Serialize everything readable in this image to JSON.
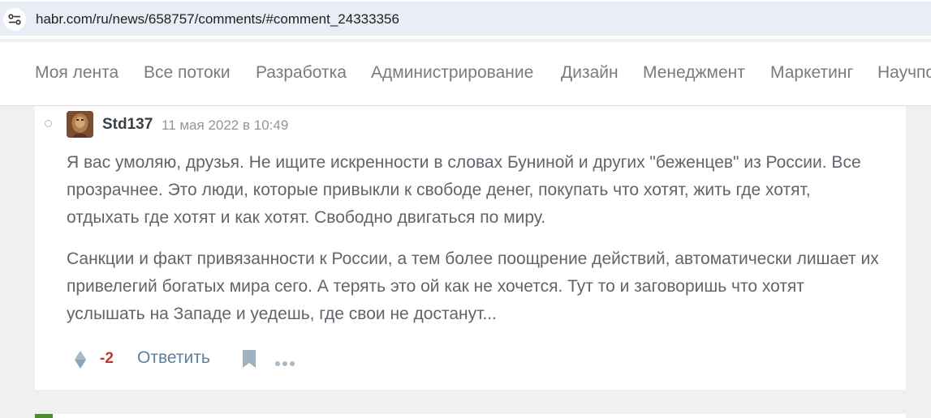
{
  "browser": {
    "url": "habr.com/ru/news/658757/comments/#comment_24333356",
    "site_icon": "tune-icon"
  },
  "nav": {
    "items": [
      {
        "label": "Моя лента"
      },
      {
        "label": "Все потоки"
      },
      {
        "label": "Разработка"
      },
      {
        "label": "Администрирование"
      },
      {
        "label": "Дизайн"
      },
      {
        "label": "Менеджмент"
      },
      {
        "label": "Маркетинг"
      },
      {
        "label": "Научпоп"
      }
    ]
  },
  "comment": {
    "author": "Std137",
    "time": "11 мая 2022 в 10:49",
    "paragraphs": [
      "Я вас умоляю, друзья. Не ищите искренности в словах Буниной и других \"беженцев\" из России. Все прозрачнее. Это люди, которые привыкли к свободе денег, покупать что хотят, жить где хотят, отдыхать где хотят и как хотят. Свободно двигаться по миру.",
      "Санкции и факт привязанности к России, а тем более поощрение действий, автоматически лишает их привелегий богатых мира сего. А терять это ой как не хочется. Тут то и заговоришь что хотят услышать на Западе и уедешь, где свои не достанут..."
    ],
    "score": "-2",
    "reply_label": "Ответить"
  },
  "colors": {
    "score_negative": "#c0392b",
    "link": "#5e7e9b",
    "text": "#5f656b",
    "accent_green": "#4e8b2a"
  }
}
